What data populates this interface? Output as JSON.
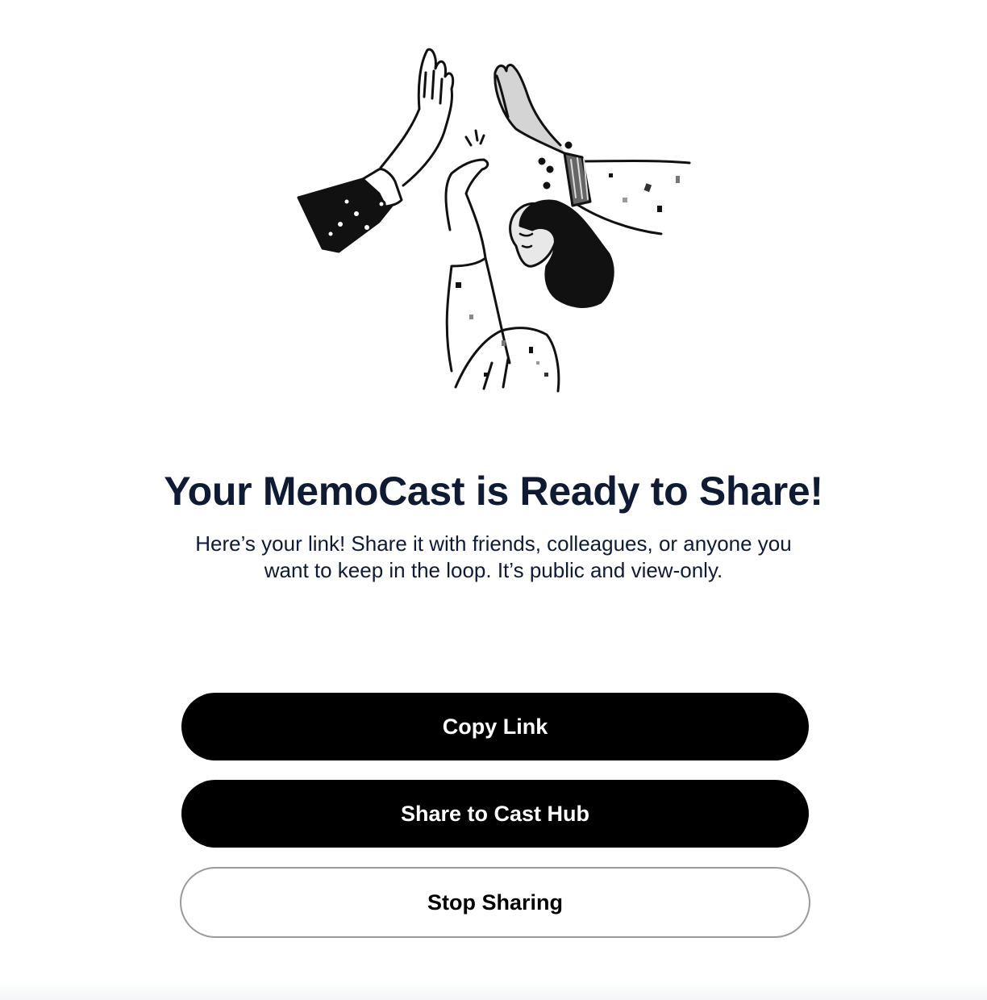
{
  "header": {
    "title": "Your MemoCast is Ready to Share!",
    "subtitle": "Here’s your link! Share it with friends, colleagues, or anyone you want to keep in the loop. It’s public and view-only."
  },
  "illustration": {
    "icon": "high-five-illustration"
  },
  "actions": {
    "copy_link_label": "Copy Link",
    "share_hub_label": "Share to Cast Hub",
    "stop_sharing_label": "Stop Sharing"
  },
  "colors": {
    "title": "#0f1a33",
    "primary_button": "#000000",
    "secondary_border": "#9a9a9a"
  }
}
